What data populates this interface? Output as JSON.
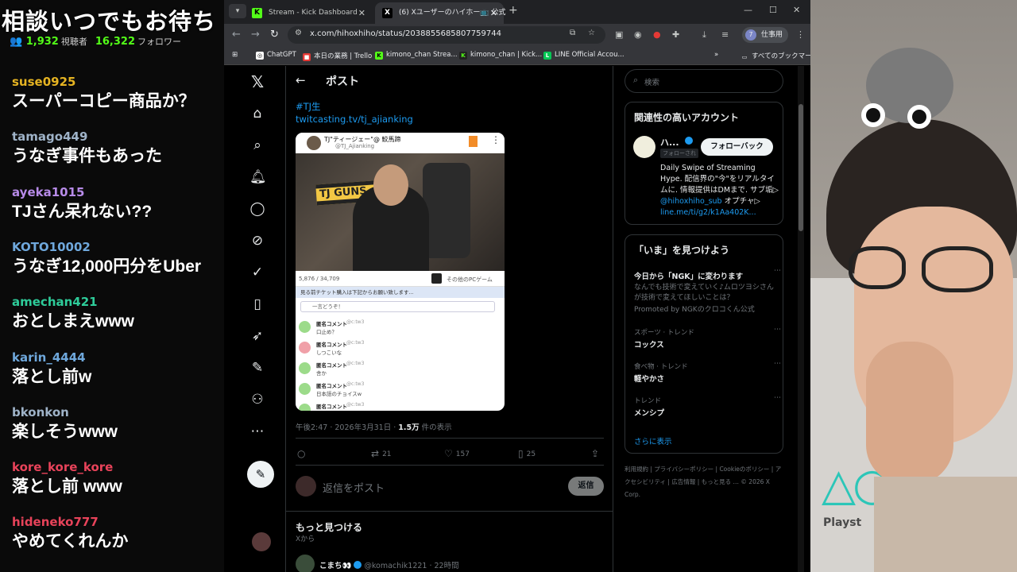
{
  "chat": {
    "banner": "相談いつでもお待ち",
    "viewers": "1,932",
    "viewers_label": "視聴者",
    "followers": "16,322",
    "followers_label": "フォロワー",
    "messages": [
      {
        "user": "suse0925",
        "color": "#e6b422",
        "text": "スーパーコピー商品か？"
      },
      {
        "user": "tamago449",
        "color": "#9fb3c8",
        "text": "うなぎ事件もあった"
      },
      {
        "user": "ayeka1015",
        "color": "#b78be8",
        "text": "TJさん呆れない??"
      },
      {
        "user": "KOTO10002",
        "color": "#6fa8dc",
        "text": "うなぎ12,000円分をUber"
      },
      {
        "user": "amechan421",
        "color": "#2ecc9a",
        "text": "おとしまえwww"
      },
      {
        "user": "karin_4444",
        "color": "#6fa8dc",
        "text": "落とし前w"
      },
      {
        "user": "bkonkon",
        "color": "#9fb3c8",
        "text": "楽しそうwww"
      },
      {
        "user": "kore_kore_kore",
        "color": "#e8435a",
        "text": "落とし前 www"
      },
      {
        "user": "hideneko777",
        "color": "#e8435a",
        "text": "やめてくれんか"
      }
    ]
  },
  "browser": {
    "tabs": [
      {
        "title": "Stream - Kick Dashboard",
        "favicon": "K",
        "active": false
      },
      {
        "title": "(6) Xユーザーのハイホー📺 公式",
        "favicon": "X",
        "active": true
      }
    ],
    "url": "x.com/hihoxhiho/status/2038855685807759744",
    "profile_label": "仕事用",
    "profile_initial": "7",
    "bookmarks": [
      "ChatGPT",
      "本日の業務 | Trello",
      "kimono_chan Strea...",
      "kimono_chan | Kick...",
      "LINE Official Accou..."
    ],
    "bookmarks_folder": "すべてのブックマーク"
  },
  "x": {
    "header_title": "ポスト",
    "hashtag": "#TJ生",
    "link": "twitcasting.tv/tj_ajianking",
    "media": {
      "name": "TJ\"ティージェー\"@ 鮫馬蹄",
      "handle": "@TJ_Ajianking",
      "banner_text": "TJ GUNS",
      "viewers": "5,876 / 34,709",
      "game": "その他のPCゲーム",
      "ticket_bar": "見る前チケット購入は下記からお願い致します...",
      "say_placeholder": "一言どうぞ！",
      "comments": [
        {
          "name": "匿名コメント",
          "id": "@c:tw3",
          "text": "口止め？",
          "color": "#9cdb8a"
        },
        {
          "name": "匿名コメント",
          "id": "@c:tw3",
          "text": "しつこいな",
          "color": "#f0a0a8"
        },
        {
          "name": "匿名コメント",
          "id": "@c:tw3",
          "text": "舎か",
          "color": "#9cdb8a"
        },
        {
          "name": "匿名コメント",
          "id": "@c:tw3",
          "text": "日本語のチョイスw",
          "color": "#9cdb8a"
        },
        {
          "name": "匿名コメント",
          "id": "@c:tw3",
          "text": "",
          "color": "#9cdb8a"
        }
      ]
    },
    "meta_time": "午後2:47 · 2026年3月31日 · ",
    "meta_views": "1.5万",
    "meta_views_label": " 件の表示",
    "actions": {
      "retweets": "21",
      "likes": "157",
      "bookmarks": "25"
    },
    "reply_placeholder": "返信をポスト",
    "reply_button": "返信",
    "more_title": "もっと見つける",
    "more_sub": "Xから",
    "next_post": {
      "name": "こまち👀",
      "handle": "@komachik1221 · 22時間"
    },
    "search_placeholder": "検索",
    "related": {
      "title": "関連性の高いアカウント",
      "name": "ハ...",
      "follows_you": "フォローされ",
      "follow_button": "フォローバック",
      "bio_1": "Daily Swipe of Streaming Hype. 配信界の\"今\"をリアルタイムに. 情報提供はDMまで. サブ垢▷ ",
      "bio_link1": "@hihoxhiho_sub",
      "bio_2": " オプチャ▷ ",
      "bio_link2": "line.me/ti/g2/k1Aa402K..."
    },
    "now": {
      "title": "「いま」を見つけよう",
      "trends": [
        {
          "category": "",
          "name": "今日から「NGK」に変わります",
          "desc": "なんでも技術で変えていく♪ムロツヨシさんが技術で変えてほしいことは？",
          "promo": "Promoted by NGKのクロコくん公式"
        },
        {
          "category": "スポーツ · トレンド",
          "name": "コックス",
          "desc": "",
          "promo": ""
        },
        {
          "category": "食べ物 · トレンド",
          "name": "軽やかさ",
          "desc": "",
          "promo": ""
        },
        {
          "category": "トレンド",
          "name": "メンシプ",
          "desc": "",
          "promo": ""
        }
      ],
      "show_more": "さらに表示"
    },
    "footer": "利用規約 | プライバシーポリシー | Cookieのポリシー | アクセシビリティ | 広告情報 | もっと見る … © 2026 X Corp."
  },
  "cam": {
    "brand": "Playst"
  }
}
